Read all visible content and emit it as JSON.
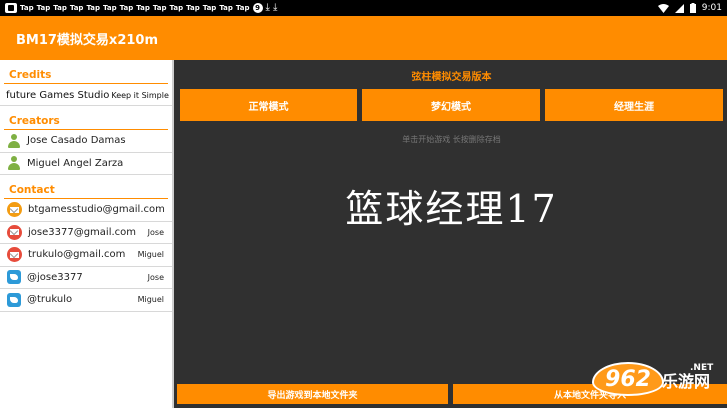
{
  "status_bar": {
    "notification_tap_label": "Tap",
    "notification_circle_label": "9",
    "time": "9:01"
  },
  "app_bar": {
    "title": "BM17模拟交易x210m"
  },
  "sidebar": {
    "credits_header": "Credits",
    "credit": {
      "name": "future Games Studio",
      "tagline": "Keep it Simple"
    },
    "creators_header": "Creators",
    "creators": [
      {
        "name": "Jose Casado Damas"
      },
      {
        "name": "Miguel Angel Zarza"
      }
    ],
    "contact_header": "Contact",
    "contacts": [
      {
        "text": "btgamesstudio@gmail.com",
        "owner": "",
        "icon": "mail-icon",
        "color": "#f39c12"
      },
      {
        "text": "jose3377@gmail.com",
        "owner": "Jose",
        "icon": "mail-icon",
        "color": "#e74c3c"
      },
      {
        "text": "trukulo@gmail.com",
        "owner": "Miguel",
        "icon": "mail-icon",
        "color": "#e74c3c"
      },
      {
        "text": "@jose3377",
        "owner": "Jose",
        "icon": "twitter-icon",
        "color": "#2d9ad8"
      },
      {
        "text": "@trukulo",
        "owner": "Miguel",
        "icon": "twitter-icon",
        "color": "#2d9ad8"
      }
    ]
  },
  "main": {
    "version_label": "弦柱模拟交易版本",
    "modes": [
      {
        "label": "正常模式"
      },
      {
        "label": "梦幻模式"
      },
      {
        "label": "经理生涯"
      }
    ],
    "hint": "单击开始游戏 长按删除存档",
    "game_logo": "篮球经理17",
    "export_button": "导出游戏到本地文件夹",
    "import_button": "从本地文件夹导入"
  },
  "watermark": {
    "badge": "962",
    "site": "乐游网",
    "tld": ".NET"
  },
  "colors": {
    "accent": "#ff8c00",
    "background": "#303030",
    "sidebar": "#ffffff"
  }
}
